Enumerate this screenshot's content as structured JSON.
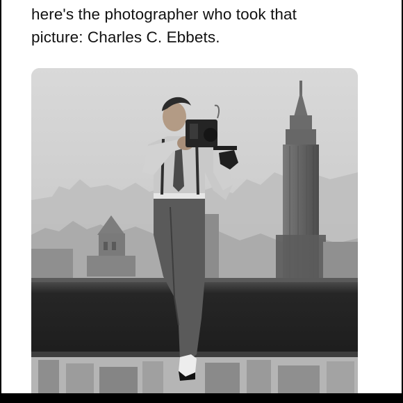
{
  "post": {
    "text_line_1": "here's the photographer who took that",
    "text_line_2": "picture: Charles C. Ebbets."
  },
  "photo": {
    "subject": "black-and-white photograph of a man photographing with a camera while sitting on a steel beam above a city skyline",
    "colors": {
      "sky": "#d4d4d4",
      "beam": "#2a2a2a",
      "tower": "#6a6a6a"
    }
  }
}
